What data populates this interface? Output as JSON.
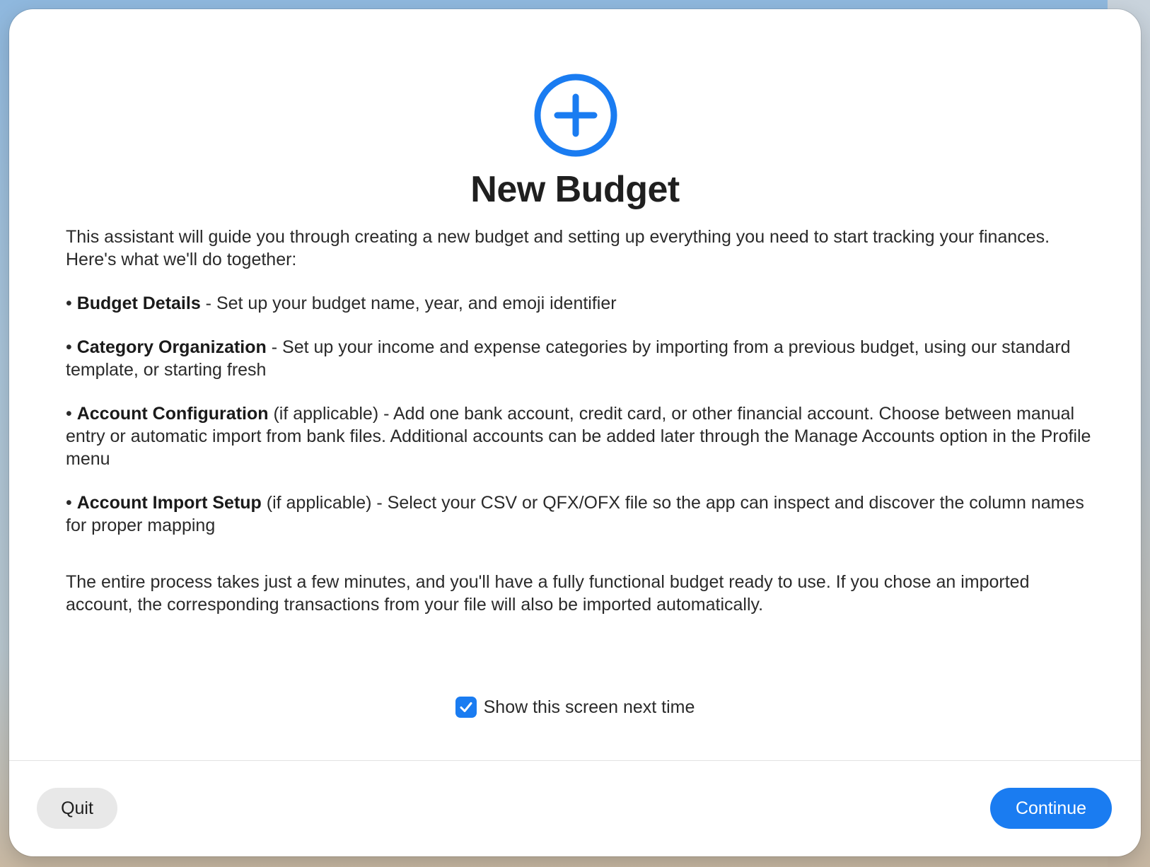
{
  "dialog": {
    "title": "New Budget",
    "accent_color": "#1a7cf1",
    "icon": "plus-circle-icon"
  },
  "intro": "This assistant will guide you through creating a new budget and setting up everything you need to start tracking your finances. Here's what we'll do together:",
  "steps": [
    {
      "heading": "Budget Details",
      "qualifier": "",
      "text": " - Set up your budget name, year, and emoji identifier"
    },
    {
      "heading": "Category Organization",
      "qualifier": "",
      "text": " - Set up your income and expense categories by importing from a previous budget, using our standard template, or starting fresh"
    },
    {
      "heading": "Account Configuration",
      "qualifier": " (if applicable)",
      "text": " - Add one bank account, credit card, or other financial account. Choose between manual entry or automatic import from bank files. Additional accounts can be added later through the Manage Accounts option in the Profile menu"
    },
    {
      "heading": "Account Import Setup",
      "qualifier": " (if applicable)",
      "text": " - Select your CSV or QFX/OFX file so the app can inspect and discover the column names for proper mapping"
    }
  ],
  "closing": "The entire process takes just a few minutes, and you'll have a fully functional budget ready to use. If you chose an imported account, the corresponding transactions from your file will also be imported automatically.",
  "show_next_time": {
    "label": "Show this screen next time",
    "checked": true
  },
  "footer": {
    "quit_label": "Quit",
    "continue_label": "Continue"
  }
}
